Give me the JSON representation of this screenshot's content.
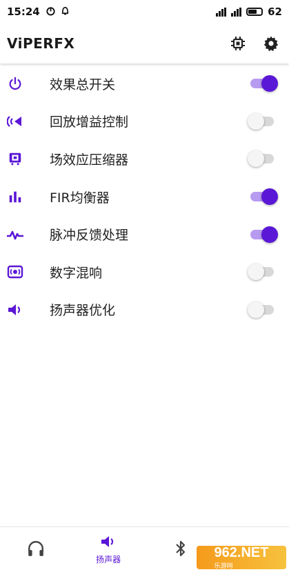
{
  "status": {
    "time": "15:24",
    "battery": "62"
  },
  "app": {
    "title": "ViPERFX"
  },
  "colors": {
    "accent": "#5b17d6",
    "track_on": "#b79bf0",
    "track_off": "#d8d8d8"
  },
  "items": [
    {
      "label": "效果总开关",
      "icon": "power-icon",
      "on": true
    },
    {
      "label": "回放增益控制",
      "icon": "playback-gain-icon",
      "on": false
    },
    {
      "label": "场效应压缩器",
      "icon": "compressor-icon",
      "on": false
    },
    {
      "label": "FIR均衡器",
      "icon": "equalizer-icon",
      "on": true
    },
    {
      "label": "脉冲反馈处理",
      "icon": "pulse-icon",
      "on": true
    },
    {
      "label": "数字混响",
      "icon": "reverb-icon",
      "on": false
    },
    {
      "label": "扬声器优化",
      "icon": "speaker-icon",
      "on": false
    }
  ],
  "nav": {
    "speaker_label": "扬声器"
  },
  "watermark": {
    "text": "962.NET",
    "sub": "乐游网"
  }
}
